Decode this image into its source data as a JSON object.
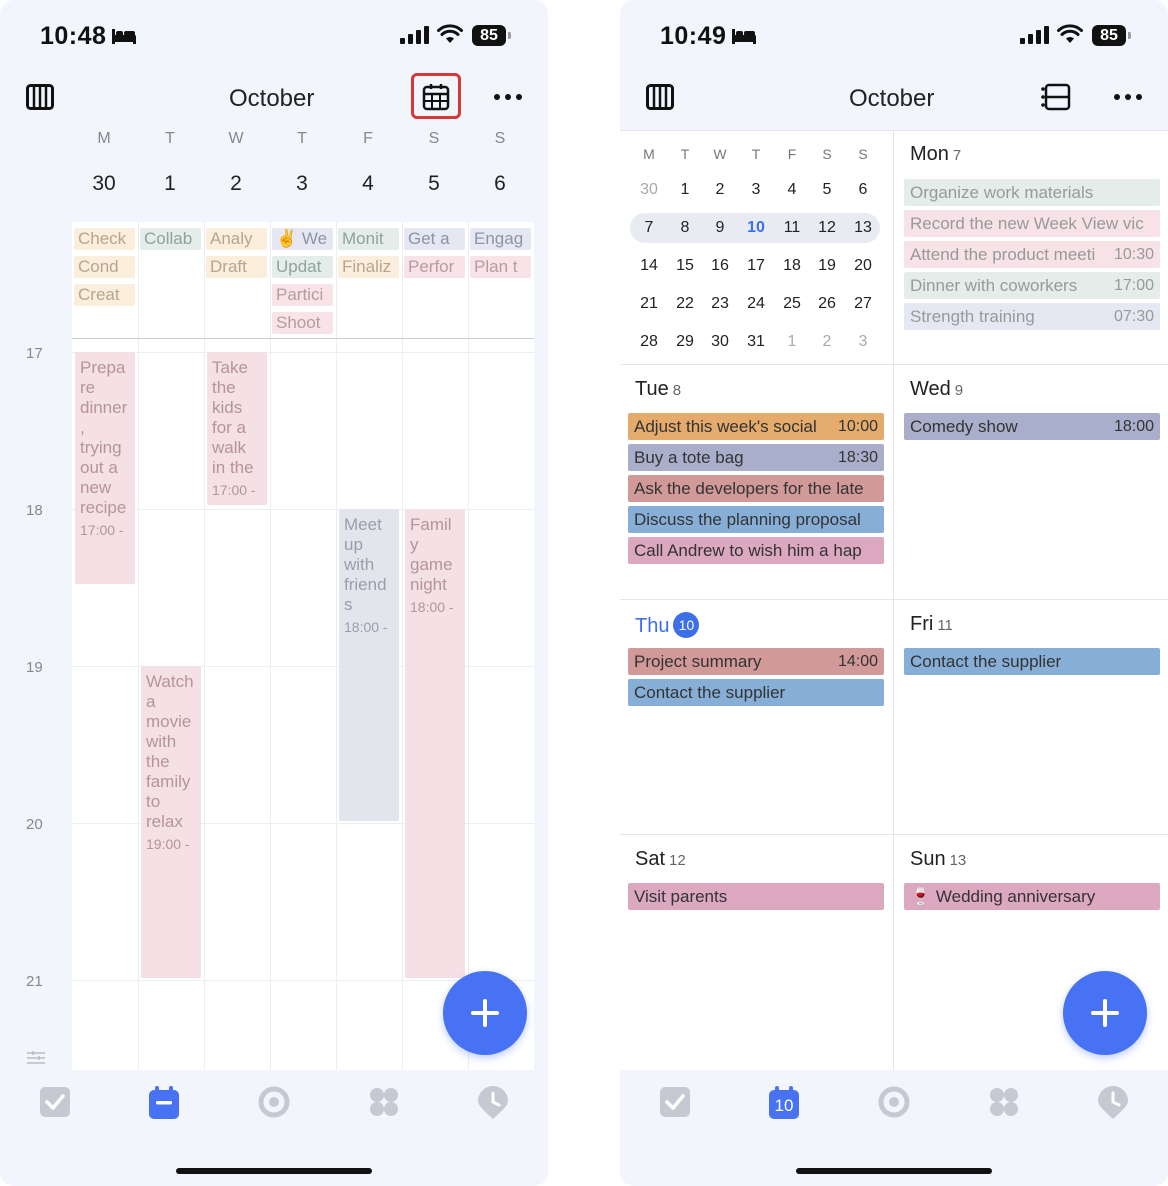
{
  "left": {
    "status": {
      "time": "10:48",
      "battery": "85"
    },
    "title": "October",
    "weekday_letters": [
      "M",
      "T",
      "W",
      "T",
      "F",
      "S",
      "S"
    ],
    "dates": [
      "30",
      "1",
      "2",
      "3",
      "4",
      "5",
      "6"
    ],
    "hour_labels": [
      "17",
      "18",
      "19",
      "20",
      "21"
    ],
    "allday": {
      "mon": [
        "Check",
        "Cond",
        "Creat"
      ],
      "tue": [
        "Collab"
      ],
      "wed": [
        "Analy",
        "Draft"
      ],
      "thu": [
        "✌️ We",
        "Updat",
        "Partici",
        "Shoot"
      ],
      "fri": [
        "Monit",
        "Finaliz"
      ],
      "sat": [
        "Get a",
        "Perfor"
      ],
      "sun": [
        "Engag",
        "Plan t"
      ]
    },
    "events": {
      "e1": {
        "title": "Prepare dinner, trying out a new recipe",
        "time": "17:00 -"
      },
      "e2": {
        "title": "Take the kids for a walk in the",
        "time": "17:00 -"
      },
      "e3": {
        "title": "Meet up with friends",
        "time": "18:00 -"
      },
      "e4": {
        "title": "Family game night",
        "time": "18:00 -"
      },
      "e5": {
        "title": "Watch a movie with the family to relax",
        "time": "19:00 -"
      }
    },
    "colors": {
      "accent": "#4772f3",
      "highlight": "#d43a3a"
    }
  },
  "right": {
    "status": {
      "time": "10:49",
      "battery": "85"
    },
    "title": "October",
    "mini_letters": [
      "M",
      "T",
      "W",
      "T",
      "F",
      "S",
      "S"
    ],
    "mini_weeks": [
      [
        "30",
        "1",
        "2",
        "3",
        "4",
        "5",
        "6"
      ],
      [
        "7",
        "8",
        "9",
        "10",
        "11",
        "12",
        "13"
      ],
      [
        "14",
        "15",
        "16",
        "17",
        "18",
        "19",
        "20"
      ],
      [
        "21",
        "22",
        "23",
        "24",
        "25",
        "26",
        "27"
      ],
      [
        "28",
        "29",
        "30",
        "31",
        "1",
        "2",
        "3"
      ]
    ],
    "days": {
      "mon": {
        "name": "Mon",
        "num": "7",
        "items": [
          {
            "title": "Organize work materials",
            "time": ""
          },
          {
            "title": "Record the new Week View vic",
            "time": ""
          },
          {
            "title": "Attend the product meeti",
            "time": "10:30"
          },
          {
            "title": "Dinner with coworkers",
            "time": "17:00"
          },
          {
            "title": "Strength training",
            "time": "07:30"
          }
        ]
      },
      "tue": {
        "name": "Tue",
        "num": "8",
        "items": [
          {
            "title": "Adjust this week's social",
            "time": "10:00"
          },
          {
            "title": "Buy a tote bag",
            "time": "18:30"
          },
          {
            "title": "Ask the developers for the late",
            "time": ""
          },
          {
            "title": "Discuss the planning proposal",
            "time": ""
          },
          {
            "title": "Call Andrew to wish him a hap",
            "time": ""
          }
        ]
      },
      "wed": {
        "name": "Wed",
        "num": "9",
        "items": [
          {
            "title": "Comedy show",
            "time": "18:00"
          }
        ]
      },
      "thu": {
        "name": "Thu",
        "num": "10",
        "items": [
          {
            "title": "Project summary",
            "time": "14:00"
          },
          {
            "title": "Contact the supplier",
            "time": ""
          }
        ]
      },
      "fri": {
        "name": "Fri",
        "num": "11",
        "items": [
          {
            "title": "Contact the supplier",
            "time": ""
          }
        ]
      },
      "sat": {
        "name": "Sat",
        "num": "12",
        "items": [
          {
            "title": "Visit parents",
            "time": ""
          }
        ]
      },
      "sun": {
        "name": "Sun",
        "num": "13",
        "items": [
          {
            "title": "🍷 Wedding anniversary",
            "time": ""
          }
        ]
      }
    },
    "tab_calendar_badge": "10"
  }
}
